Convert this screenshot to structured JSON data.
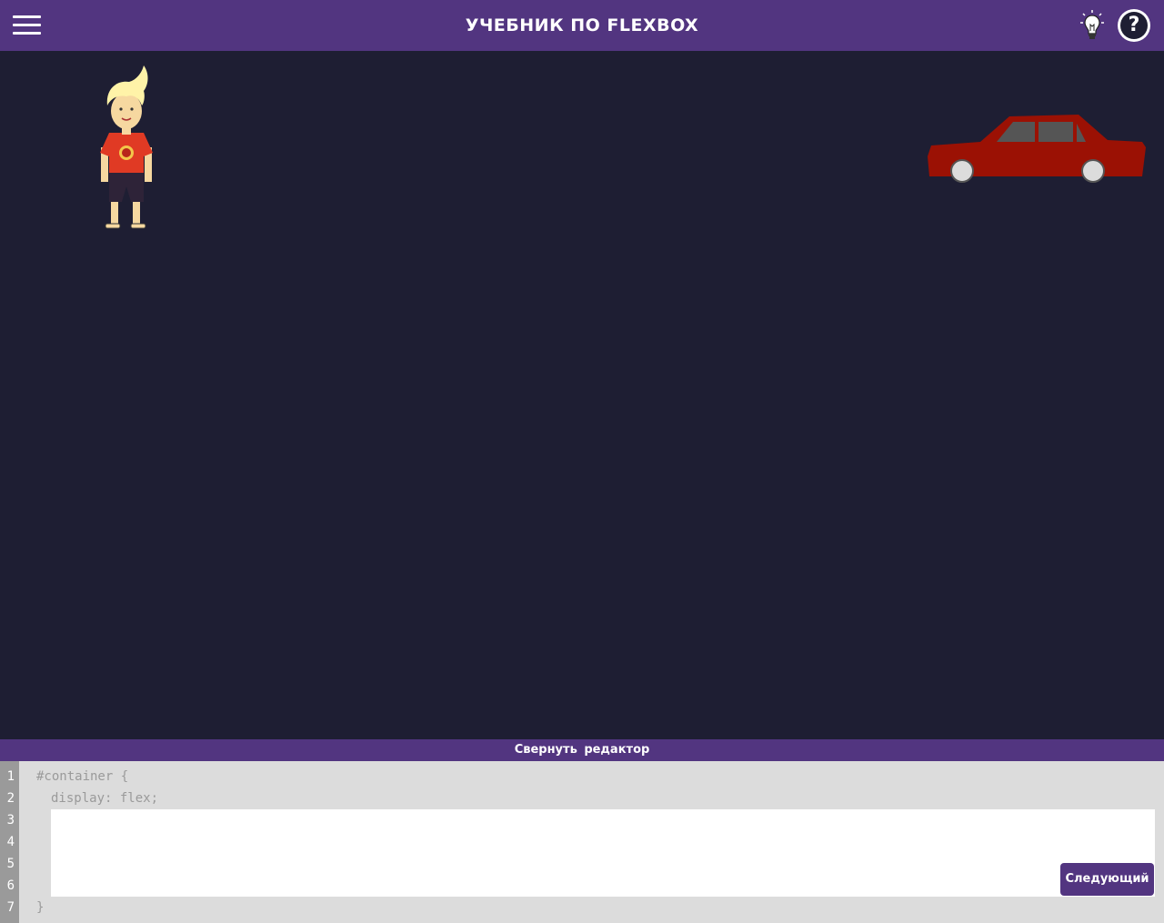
{
  "header": {
    "title": "УЧЕБНИК ПО FLEXBOX",
    "menu_icon": "hamburger-menu-icon",
    "hint_icon": "lightbulb-icon",
    "help_icon": "question-mark-icon",
    "help_symbol": "?"
  },
  "stage": {
    "characters": [
      "boy-figure",
      "red-car"
    ]
  },
  "editor": {
    "collapse_label": "Свернуть редактор",
    "line_numbers": [
      "1",
      "2",
      "3",
      "4",
      "5",
      "6",
      "7"
    ],
    "code_lines": [
      "#container {",
      "display: flex;",
      "}"
    ],
    "input_value": "",
    "next_button_label": "Следующий"
  },
  "colors": {
    "header_bg": "#523580",
    "stage_bg": "#1e1e33",
    "editor_bg": "#dcdcdc",
    "gutter_bg": "#9a9a9a",
    "car": "#9b1104"
  }
}
